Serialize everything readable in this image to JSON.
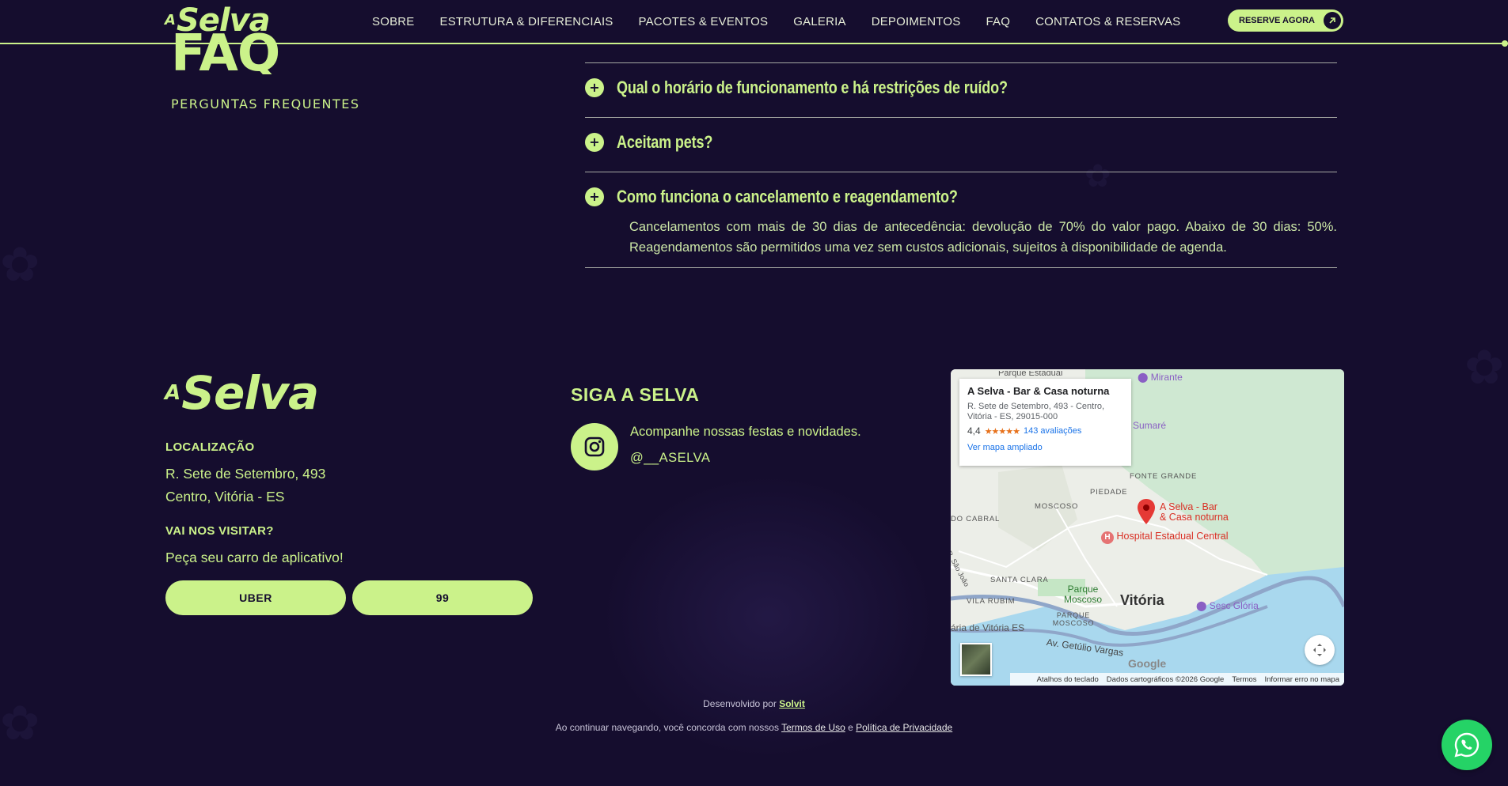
{
  "header": {
    "logo": "Selva",
    "logo_prefix": "A",
    "nav": [
      "SOBRE",
      "ESTRUTURA & DIFERENCIAIS",
      "PACOTES & EVENTOS",
      "GALERIA",
      "DEPOIMENTOS",
      "FAQ",
      "CONTATOS & RESERVAS"
    ],
    "reserve_label": "RESERVE AGORA",
    "reserve_icon": "arrow-up-right-icon"
  },
  "faq": {
    "title": "FAQ",
    "subtitle": "PERGUNTAS FREQUENTES",
    "items": [
      {
        "question": "Qual o horário de funcionamento e há restrições de ruído?"
      },
      {
        "question": "Aceitam pets?"
      },
      {
        "question": "Como funciona o cancelamento e reagendamento?",
        "answer": "Cancelamentos com mais de 30 dias de antecedência: devolução de 70% do valor pago. Abaixo de 30 dias: 50%. Reagendamentos são permitidos uma vez sem custos adicionais, sujeitos à disponibilidade de agenda."
      }
    ]
  },
  "footer": {
    "logo": "Selva",
    "logo_prefix": "A",
    "location_label": "LOCALIZAÇÃO",
    "address_line1": "R. Sete de Setembro, 493",
    "address_line2": "Centro, Vitória - ES",
    "visit_label": "VAI NOS VISITAR?",
    "visit_text": "Peça seu carro de aplicativo!",
    "uber_label": "UBER",
    "ninenine_label": "99",
    "social_title": "SIGA A SELVA",
    "social_text": "Acompanhe nossas festas e novidades.",
    "social_handle": "@__ASELVA",
    "social_icon": "instagram-icon"
  },
  "map": {
    "place_title": "A Selva - Bar & Casa noturna",
    "place_address": "R. Sete de Setembro, 493 - Centro, Vitória - ES, 29015-000",
    "rating": "4,4",
    "stars": "★★★★★",
    "reviews": "143 avaliações",
    "enlarge_link": "Ver mapa ampliado",
    "labels": {
      "mirante": "Mirante",
      "sumare": "Sumaré",
      "fonte_grande": "FONTE GRANDE",
      "piedade": "PIEDADE",
      "moscoso": "MOSCOSO",
      "cabral": "DO CABRAL",
      "pin_label_1": "A Selva - Bar",
      "pin_label_2": "& Casa noturna",
      "hospital": "Hospital Estadual Central",
      "sao_joao": "R. São João",
      "santa_clara": "SANTA CLARA",
      "parque_moscoso": "Parque Moscoso",
      "vila_rubim": "VILA RUBIM",
      "parque_moscoso_area": "PARQUE MOSCOSO",
      "vitoria": "Vitória",
      "sesc": "Sesc Glória",
      "vitoria_es": "ária de Vitória ES",
      "getulio": "Av. Getúlio Vargas",
      "google": "Google",
      "top_cut": "Parque Estadual"
    },
    "bar": [
      "Atalhos do teclado",
      "Dados cartográficos ©2026 Google",
      "Termos",
      "Informar erro no mapa"
    ]
  },
  "credits": {
    "dev_prefix": "Desenvolvido por",
    "dev_name": "Solvit",
    "consent_prefix": "Ao continuar navegando, você concorda com nossos",
    "terms": "Termos de Uso",
    "and": "e",
    "privacy": "Política de Privacidade"
  },
  "whatsapp_icon": "whatsapp-icon",
  "colors": {
    "background": "#150d2e",
    "accent": "#cbf28a",
    "whatsapp": "#25d366"
  }
}
